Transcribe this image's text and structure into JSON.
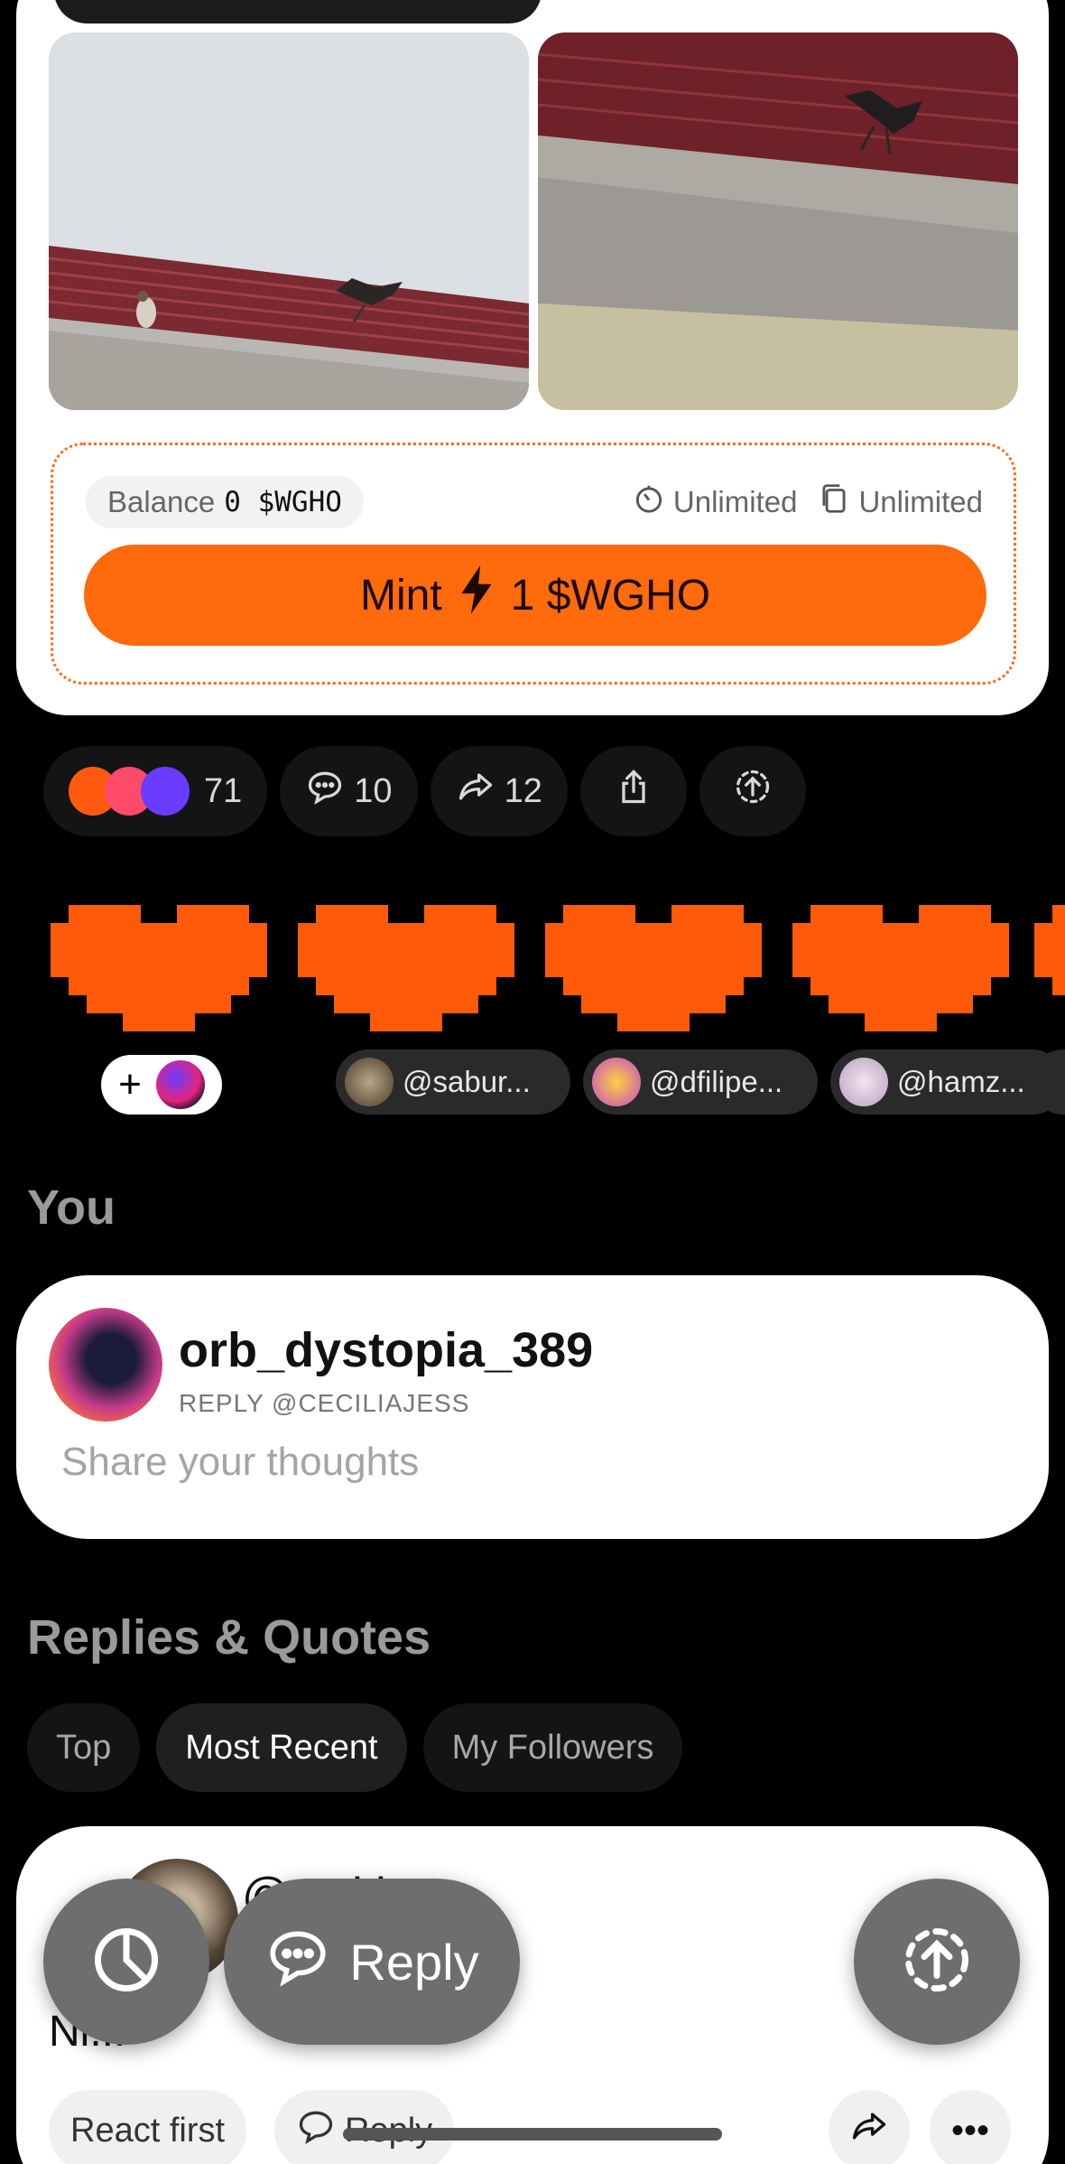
{
  "mint": {
    "balance_label": "Balance",
    "balance_value": "0 $WGHO",
    "time_limit": "Unlimited",
    "supply_limit": "Unlimited",
    "mint_label": "Mint",
    "mint_price": "1 $WGHO",
    "accent_color": "#ff6a0d"
  },
  "actions": {
    "reactions_count": "71",
    "comments_count": "10",
    "reposts_count": "12"
  },
  "reactors": [
    {
      "handle": "@sabur..."
    },
    {
      "handle": "@dfilipe..."
    },
    {
      "handle": "@hamz..."
    }
  ],
  "you": {
    "title": "You",
    "username": "orb_dystopia_389",
    "reply_to": "REPLY @CECILIAJESS",
    "placeholder": "Share your thoughts"
  },
  "replies": {
    "title": "Replies & Quotes",
    "tabs": [
      "Top",
      "Most Recent",
      "My Followers"
    ],
    "active_tab": "Most Recent",
    "first_reply": {
      "name": "@...skix",
      "text": "Ni...",
      "react_first": "React first",
      "reply_label": "Reply"
    }
  },
  "fab": {
    "reply_label": "Reply"
  }
}
